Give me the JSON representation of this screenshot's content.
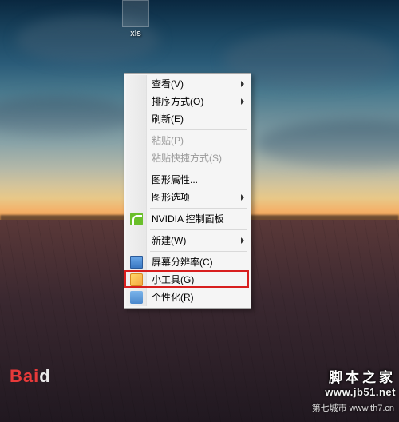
{
  "desktop": {
    "icon": {
      "label": "xls"
    }
  },
  "context_menu": {
    "items": [
      {
        "label": "查看(V)",
        "submenu": true,
        "icon": null,
        "enabled": true
      },
      {
        "label": "排序方式(O)",
        "submenu": true,
        "icon": null,
        "enabled": true
      },
      {
        "label": "刷新(E)",
        "submenu": false,
        "icon": null,
        "enabled": true
      },
      {
        "sep": true
      },
      {
        "label": "粘贴(P)",
        "submenu": false,
        "icon": null,
        "enabled": false
      },
      {
        "label": "粘贴快捷方式(S)",
        "submenu": false,
        "icon": null,
        "enabled": false
      },
      {
        "sep": true
      },
      {
        "label": "图形属性...",
        "submenu": false,
        "icon": null,
        "enabled": true
      },
      {
        "label": "图形选项",
        "submenu": true,
        "icon": null,
        "enabled": true
      },
      {
        "sep": true
      },
      {
        "label": "NVIDIA 控制面板",
        "submenu": false,
        "icon": "nvidia",
        "enabled": true
      },
      {
        "sep": true
      },
      {
        "label": "新建(W)",
        "submenu": true,
        "icon": null,
        "enabled": true
      },
      {
        "sep": true
      },
      {
        "label": "屏幕分辨率(C)",
        "submenu": false,
        "icon": "screen",
        "enabled": true
      },
      {
        "label": "小工具(G)",
        "submenu": false,
        "icon": "gadget",
        "enabled": true,
        "highlighted": true
      },
      {
        "label": "个性化(R)",
        "submenu": false,
        "icon": "personal",
        "enabled": true
      }
    ]
  },
  "watermarks": {
    "baidu_left": "Bai",
    "baidu_right": "d",
    "jb51_line1": "脚本之家",
    "jb51_line2": "www.jb51.net",
    "th7": "第七城市   www.th7.cn"
  }
}
